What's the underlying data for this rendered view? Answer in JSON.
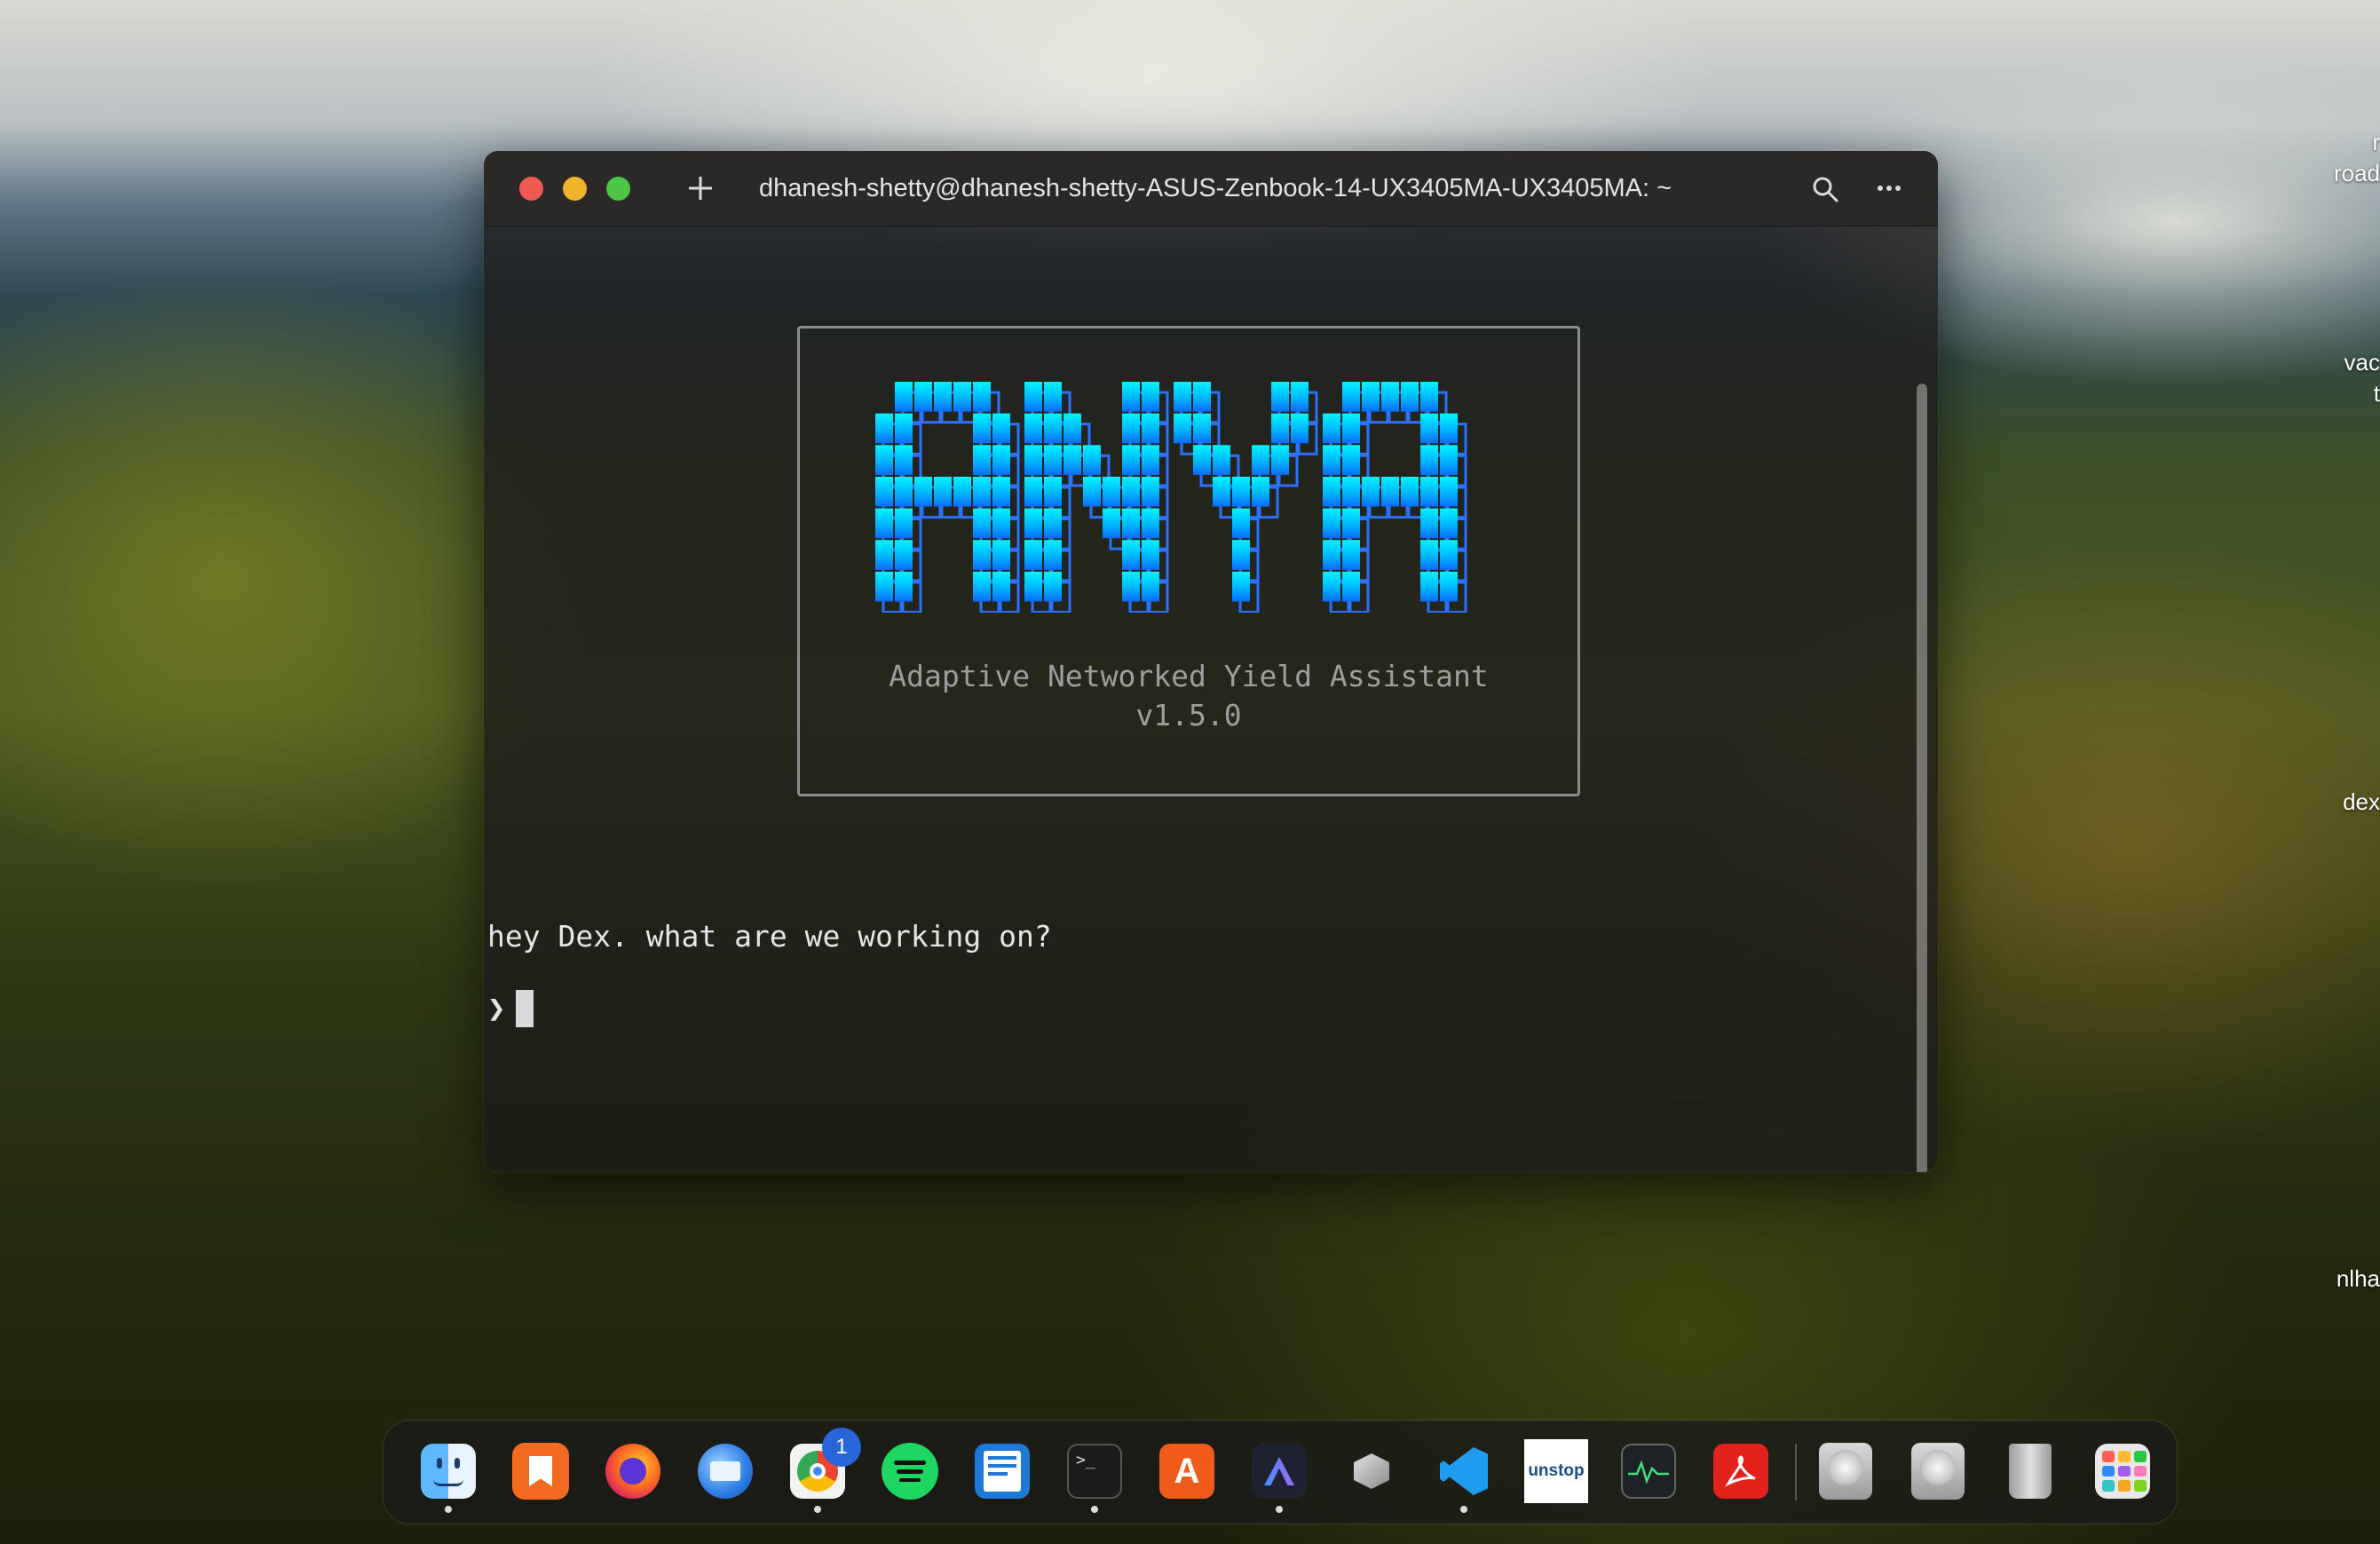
{
  "desktop": {
    "labels": [
      "r",
      "road",
      "vac",
      "t",
      "dex",
      "nlha"
    ]
  },
  "terminal": {
    "title": "dhanesh-shetty@dhanesh-shetty-ASUS-Zenbook-14-UX3405MA-UX3405MA: ~",
    "new_tab_icon": "plus-icon",
    "search_icon": "search-icon",
    "menu_icon": "more-icon",
    "banner": {
      "logo_text": "ANYA",
      "subtitle": "Adaptive Networked Yield Assistant",
      "version": "v1.5.0",
      "logo_colors": [
        "#00f0ff",
        "#00a8ff",
        "#0066ff"
      ]
    },
    "greeting": "hey Dex. what are we working on?",
    "prompt_symbol": "❯"
  },
  "dock": {
    "apps": [
      {
        "name": "Finder",
        "icon": "finder-icon",
        "running": true
      },
      {
        "name": "Bookmarks",
        "icon": "bookmark-icon",
        "running": false
      },
      {
        "name": "Firefox",
        "icon": "firefox-icon",
        "running": false
      },
      {
        "name": "Thunderbird",
        "icon": "thunderbird-icon",
        "running": false
      },
      {
        "name": "Chrome",
        "icon": "chrome-icon",
        "running": true,
        "badge": "1"
      },
      {
        "name": "Spotify",
        "icon": "spotify-icon",
        "running": false
      },
      {
        "name": "Text Editor",
        "icon": "text-editor-icon",
        "running": false
      },
      {
        "name": "Terminal",
        "icon": "terminal-icon",
        "running": true
      },
      {
        "name": "App Store",
        "icon": "app-store-icon",
        "running": false
      },
      {
        "name": "Antigravity",
        "icon": "antigravity-icon",
        "running": true
      },
      {
        "name": "Cube",
        "icon": "cube-icon",
        "running": false
      },
      {
        "name": "VS Code",
        "icon": "vscode-icon",
        "running": true
      },
      {
        "name": "Unstop",
        "icon": "unstop-icon",
        "running": false,
        "label": "unstop"
      },
      {
        "name": "Activity Monitor",
        "icon": "activity-monitor-icon",
        "running": false
      },
      {
        "name": "Acrobat",
        "icon": "acrobat-icon",
        "running": false
      },
      {
        "name": "Disk 1",
        "icon": "disk-icon",
        "running": false
      },
      {
        "name": "Disk 2",
        "icon": "disk-icon",
        "running": false
      },
      {
        "name": "Trash",
        "icon": "trash-icon",
        "running": false
      },
      {
        "name": "Launchpad",
        "icon": "launchpad-icon",
        "running": false
      }
    ]
  }
}
